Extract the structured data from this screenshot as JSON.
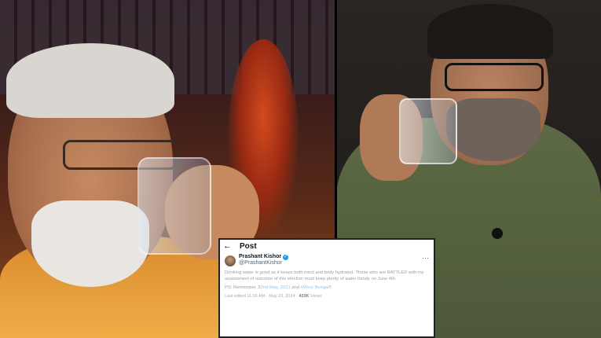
{
  "tweet": {
    "topbar_title": "Post",
    "back_icon": "arrow-left-icon",
    "author_name": "Prashant Kishor",
    "author_handle": "@PrashantKishor",
    "verified_icon": "verified-badge-icon",
    "more_icon": "more-icon",
    "body_text": "Drinking water is good as it keeps both mind and body hydrated. Those who are RATTLED with my assessment of outcome of this election must keep plenty of water handy on June 4th.",
    "ps_text_prefix": "PS: Remember, 2",
    "ps_link1": "2nd May, 2021",
    "ps_text_mid": " and ",
    "ps_link2": "#West Bengal",
    "ps_text_suffix": "!!",
    "last_edited": "Last edited 11:55 AM · May 23, 2024 ·",
    "views_count": "433K",
    "views_label": "Views"
  },
  "colors": {
    "verified": "#1d9bf0",
    "link": "#9cc3e8",
    "text_primary": "#0f1419",
    "text_secondary": "#536471"
  }
}
